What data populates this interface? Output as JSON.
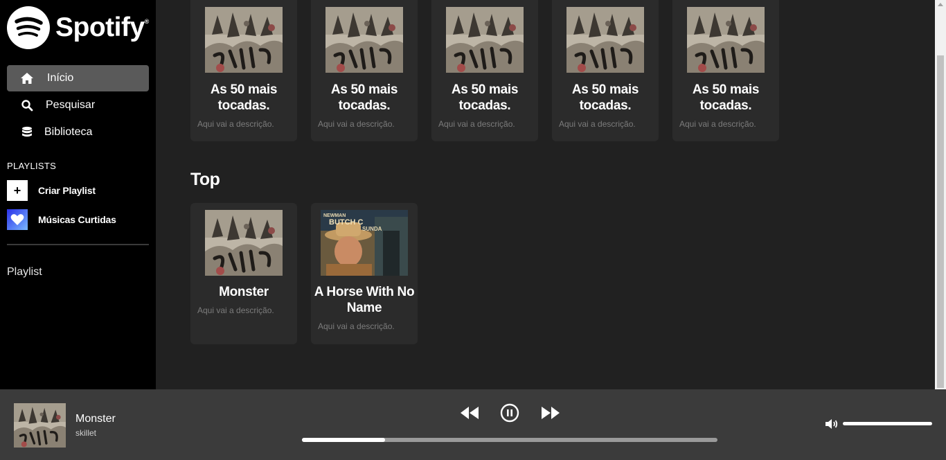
{
  "app": {
    "logo_text": "Spotify",
    "logo_reg": "®"
  },
  "sidebar": {
    "nav": [
      {
        "label": "Início",
        "icon": "home-icon",
        "active": true
      },
      {
        "label": "Pesquisar",
        "icon": "search-icon",
        "active": false
      },
      {
        "label": "Biblioteca",
        "icon": "library-icon",
        "active": false
      }
    ],
    "playlists_title": "PLAYLISTS",
    "create_playlist": {
      "symbol": "+",
      "label": "Criar Playlist"
    },
    "liked_songs": {
      "label": "Músicas Curtidas"
    },
    "playlist_link": "Playlist"
  },
  "main": {
    "top_row": [
      {
        "title": "As 50 mais tocadas.",
        "description": "Aqui vai a descrição.",
        "cover": "skillet-cover"
      },
      {
        "title": "As 50 mais tocadas.",
        "description": "Aqui vai a descrição.",
        "cover": "skillet-cover"
      },
      {
        "title": "As 50 mais tocadas.",
        "description": "Aqui vai a descrição.",
        "cover": "skillet-cover"
      },
      {
        "title": "As 50 mais tocadas.",
        "description": "Aqui vai a descrição.",
        "cover": "skillet-cover"
      },
      {
        "title": "As 50 mais tocadas.",
        "description": "Aqui vai a descrição.",
        "cover": "skillet-cover"
      }
    ],
    "section_title": "Top",
    "top_section": [
      {
        "title": "Monster",
        "description": "Aqui vai a descrição.",
        "cover": "skillet-cover"
      },
      {
        "title": "A Horse With No Name",
        "description": "Aqui vai a descrição.",
        "cover": "movie-poster-cover"
      }
    ]
  },
  "player": {
    "track_title": "Monster",
    "artist": "skillet",
    "progress": 0.2,
    "volume": 1.0,
    "state": "playing",
    "colors": {
      "bar_bg": "#3b3b3b",
      "progress_track": "#9a9a9a",
      "progress_fill": "#ffffff"
    }
  }
}
